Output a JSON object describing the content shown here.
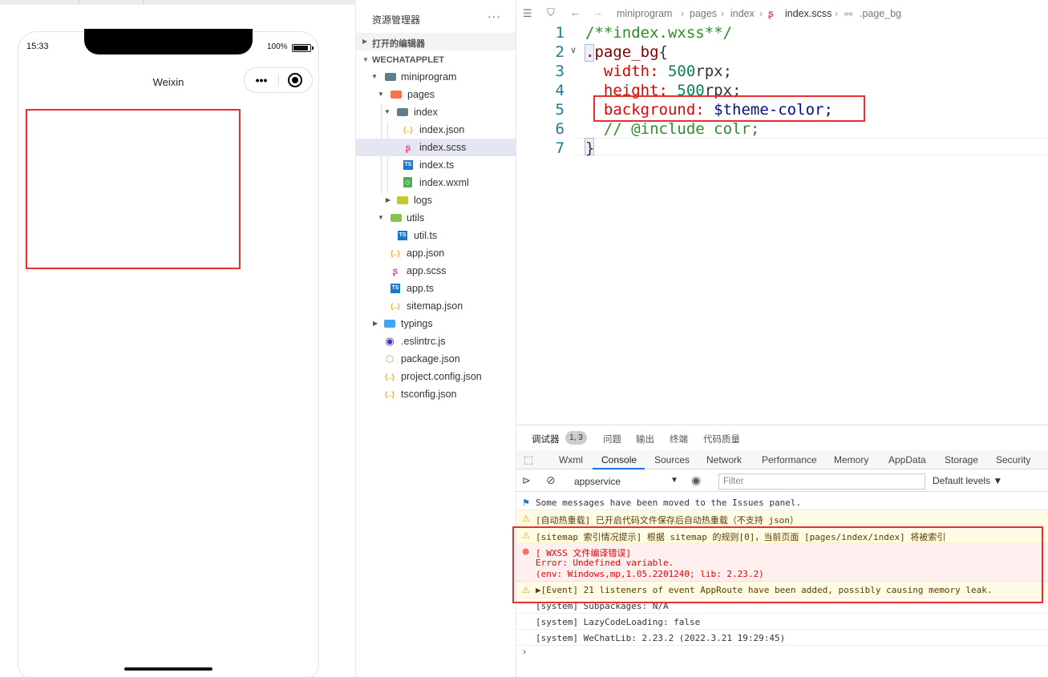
{
  "simulator": {
    "time": "15:33",
    "battery": "100%",
    "nav_title": "Weixin",
    "capsule_more": "•••"
  },
  "explorer": {
    "title": "资源管理器",
    "more": "···",
    "sections": {
      "open_editors": "打开的编辑器",
      "project": "WECHATAPPLET"
    },
    "tree": [
      {
        "name": "miniprogram"
      },
      {
        "name": "pages"
      },
      {
        "name": "index"
      },
      {
        "name": "index.json"
      },
      {
        "name": "index.scss"
      },
      {
        "name": "index.ts"
      },
      {
        "name": "index.wxml"
      },
      {
        "name": "logs"
      },
      {
        "name": "utils"
      },
      {
        "name": "util.ts"
      },
      {
        "name": "app.json"
      },
      {
        "name": "app.scss"
      },
      {
        "name": "app.ts"
      },
      {
        "name": "sitemap.json"
      },
      {
        "name": "typings"
      },
      {
        "name": ".eslintrc.js"
      },
      {
        "name": "package.json"
      },
      {
        "name": "project.config.json"
      },
      {
        "name": "tsconfig.json"
      }
    ]
  },
  "editor": {
    "breadcrumb": [
      "miniprogram",
      "pages",
      "index",
      "index.scss",
      ".page_bg"
    ],
    "line_numbers": [
      "1",
      "2",
      "3",
      "4",
      "5",
      "6",
      "7"
    ],
    "code": {
      "l1": "/**index.wxss**/",
      "l2_sel": ".page_bg",
      "l2_brace": "{",
      "l3_prop": "width:",
      "l3_num": " 500",
      "l3_unit": "rpx;",
      "l4_prop": "height:",
      "l4_num": " 500",
      "l4_unit": "rpx;",
      "l5_prop": "background:",
      "l5_var": " $theme-color;",
      "l6": "// @include colr;",
      "l7": "}"
    }
  },
  "panel": {
    "tabs": [
      "调试器",
      "问题",
      "输出",
      "终端",
      "代码质量"
    ],
    "badge": "1, 3",
    "devtools_tabs": [
      "Wxml",
      "Console",
      "Sources",
      "Network",
      "Performance",
      "Memory",
      "AppData",
      "Storage",
      "Security"
    ],
    "context": "appservice",
    "filter_placeholder": "Filter",
    "levels": "Default levels ▼",
    "messages": {
      "m1": "Some messages have been moved to the Issues panel.",
      "m2": "[自动热重载] 已开启代码文件保存后自动热重载（不支持 json）",
      "m3": "[sitemap 索引情况提示] 根据 sitemap 的规则[0]，当前页面 [pages/index/index] 将被索引",
      "m4a": "[ WXSS 文件编译错误]",
      "m4b": "Error: Undefined variable.",
      "m4c": "(env: Windows,mp,1.05.2201240; lib: 2.23.2)",
      "m5": "▶[Event] 21 listeners of event AppRoute have been added, possibly causing memory leak.",
      "m6": "[system] Subpackages: N/A",
      "m7": "[system] LazyCodeLoading: false",
      "m8": "[system] WeChatLib: 2.23.2 (2022.3.21 19:29:45)"
    }
  }
}
